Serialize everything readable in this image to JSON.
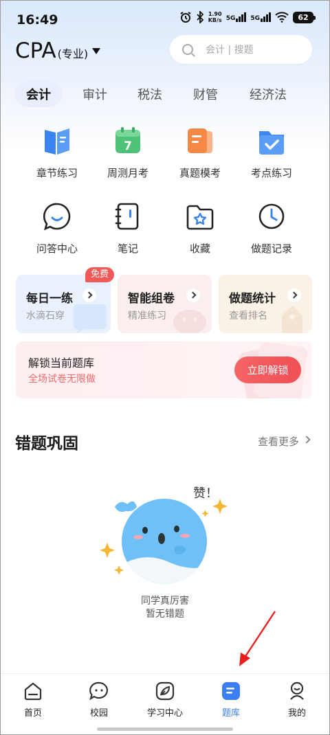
{
  "status_bar": {
    "time": "16:49",
    "net_speed": "1.90",
    "net_unit": "KB/s",
    "sig1": "5G",
    "sig2": "5G",
    "battery": "62"
  },
  "header": {
    "exam": "CPA",
    "exam_sub": "(专业)",
    "search_placeholder": "会计 | 搜题"
  },
  "tabs": [
    {
      "label": "会计",
      "active": true
    },
    {
      "label": "审计",
      "active": false
    },
    {
      "label": "税法",
      "active": false
    },
    {
      "label": "财管",
      "active": false
    },
    {
      "label": "经济法",
      "active": false
    }
  ],
  "grid": [
    {
      "label": "章节练习",
      "icon": "book-icon"
    },
    {
      "label": "周测月考",
      "icon": "calendar-icon",
      "icon_text": "7"
    },
    {
      "label": "真题模考",
      "icon": "exam-paper-icon"
    },
    {
      "label": "考点练习",
      "icon": "check-folder-icon"
    },
    {
      "label": "问答中心",
      "icon": "chat-bubble-icon"
    },
    {
      "label": "笔记",
      "icon": "notebook-icon"
    },
    {
      "label": "收藏",
      "icon": "star-folder-icon"
    },
    {
      "label": "做题记录",
      "icon": "clock-icon"
    }
  ],
  "cards": [
    {
      "title": "每日一练",
      "sub": "水滴石穿",
      "badge": "免费"
    },
    {
      "title": "智能组卷",
      "sub": "精准练习"
    },
    {
      "title": "做题统计",
      "sub": "查看排名"
    }
  ],
  "unlock": {
    "title": "解锁当前题库",
    "sub": "全场试卷无限做",
    "button": "立即解锁"
  },
  "wrong": {
    "title": "错题巩固",
    "more": "查看更多",
    "praise": "赞！",
    "empty_line1": "同学真厉害",
    "empty_line2": "暂无错题"
  },
  "nav": [
    {
      "label": "首页",
      "icon": "home-icon"
    },
    {
      "label": "校园",
      "icon": "campus-chat-icon"
    },
    {
      "label": "学习中心",
      "icon": "leaf-icon"
    },
    {
      "label": "题库",
      "icon": "question-bank-icon",
      "active": true
    },
    {
      "label": "我的",
      "icon": "profile-icon"
    }
  ],
  "colors": {
    "accent": "#3b7ff2",
    "danger": "#f0565a"
  }
}
